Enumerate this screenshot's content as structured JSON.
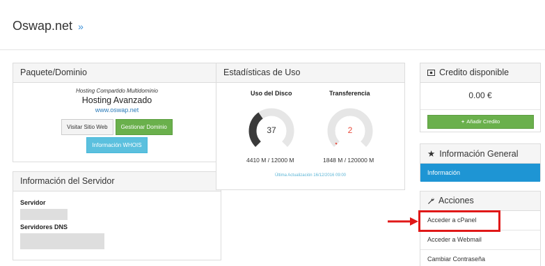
{
  "header": {
    "title": "Oswap.net",
    "chevron": "»"
  },
  "paquete": {
    "title": "Paquete/Dominio",
    "group": "Hosting Compartido Multidominio",
    "name": "Hosting Avanzado",
    "domain": "www.oswap.net",
    "btn_visit": "Visitar Sitio Web",
    "btn_manage": "Gestionar Dominio",
    "btn_whois": "Información WHOIS"
  },
  "servidor": {
    "title": "Información del Servidor",
    "server_label": "Servidor",
    "dns_label": "Servidores DNS"
  },
  "stats": {
    "title": "Estadísticas de Uso",
    "disk": {
      "title": "Uso del Disco",
      "percent": 37,
      "usage": "4410 M / 12000 M"
    },
    "transfer": {
      "title": "Transferencia",
      "percent": 2,
      "usage": "1848 M / 120000 M"
    },
    "updated": "Última Actualización 16/12/2016 09:00",
    "colors": {
      "gauge_fill": "#3a3a3a",
      "gauge_track": "#e6e6e6",
      "transfer_fill": "#e84c3d"
    }
  },
  "credito": {
    "title": "Credito disponible",
    "icon": "money-icon",
    "amount": "0.00 €",
    "add_button": "Añadir Credito",
    "add_icon": "plus-icon"
  },
  "info": {
    "title": "Información General",
    "icon": "star-icon",
    "active_item": "Información"
  },
  "acciones": {
    "title": "Acciones",
    "icon": "wrench-icon",
    "items": [
      "Acceder a cPanel",
      "Acceder a Webmail",
      "Cambiar Contraseña"
    ]
  },
  "annotation": {
    "color": "#e01818"
  }
}
